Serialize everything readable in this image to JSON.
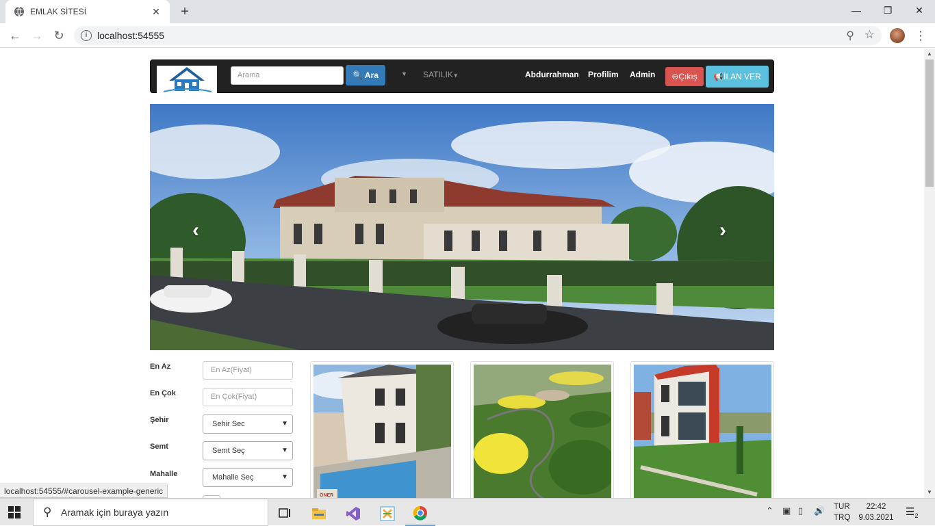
{
  "browser": {
    "tab_title": "EMLAK SİTESİ",
    "tab_close": "✕",
    "new_tab": "+",
    "url": "localhost:54555",
    "status_url": "localhost:54555/#carousel-example-generic"
  },
  "site": {
    "search_placeholder": "Arama",
    "search_button": "Ara",
    "satilik_menu": "SATILIK",
    "user_name": "Abdurrahman",
    "profile": "Profilim",
    "admin": "Admin",
    "logout": "Çıkış",
    "post_ad": "İLAN VER"
  },
  "filters": {
    "min_label": "En Az",
    "min_placeholder": "En Az(Fiyat)",
    "max_label": "En Çok",
    "max_placeholder": "En Çok(Fiyat)",
    "city_label": "Şehir",
    "city_value": "Sehir Sec",
    "district_label": "Semt",
    "district_value": "Semt Seç",
    "neighborhood_label": "Mahalle",
    "neighborhood_value": "Mahalle Seç"
  },
  "card_badges": {
    "card1": "ÖNER"
  },
  "taskbar": {
    "search_placeholder": "Aramak için buraya yazın",
    "lang_top": "TUR",
    "lang_bottom": "TRQ",
    "time": "22:42",
    "date": "9.03.2021",
    "notif_count": "2"
  },
  "icons": [
    "globe-icon",
    "back-icon",
    "forward-icon",
    "reload-icon",
    "info-icon",
    "zoom-icon",
    "star-icon",
    "menu-icon",
    "search-icon",
    "megaphone-icon",
    "chevron-left-icon",
    "chevron-right-icon",
    "windows-icon",
    "task-view-icon",
    "file-explorer-icon",
    "visual-studio-icon",
    "app-icon",
    "chrome-icon",
    "notification-icon"
  ]
}
